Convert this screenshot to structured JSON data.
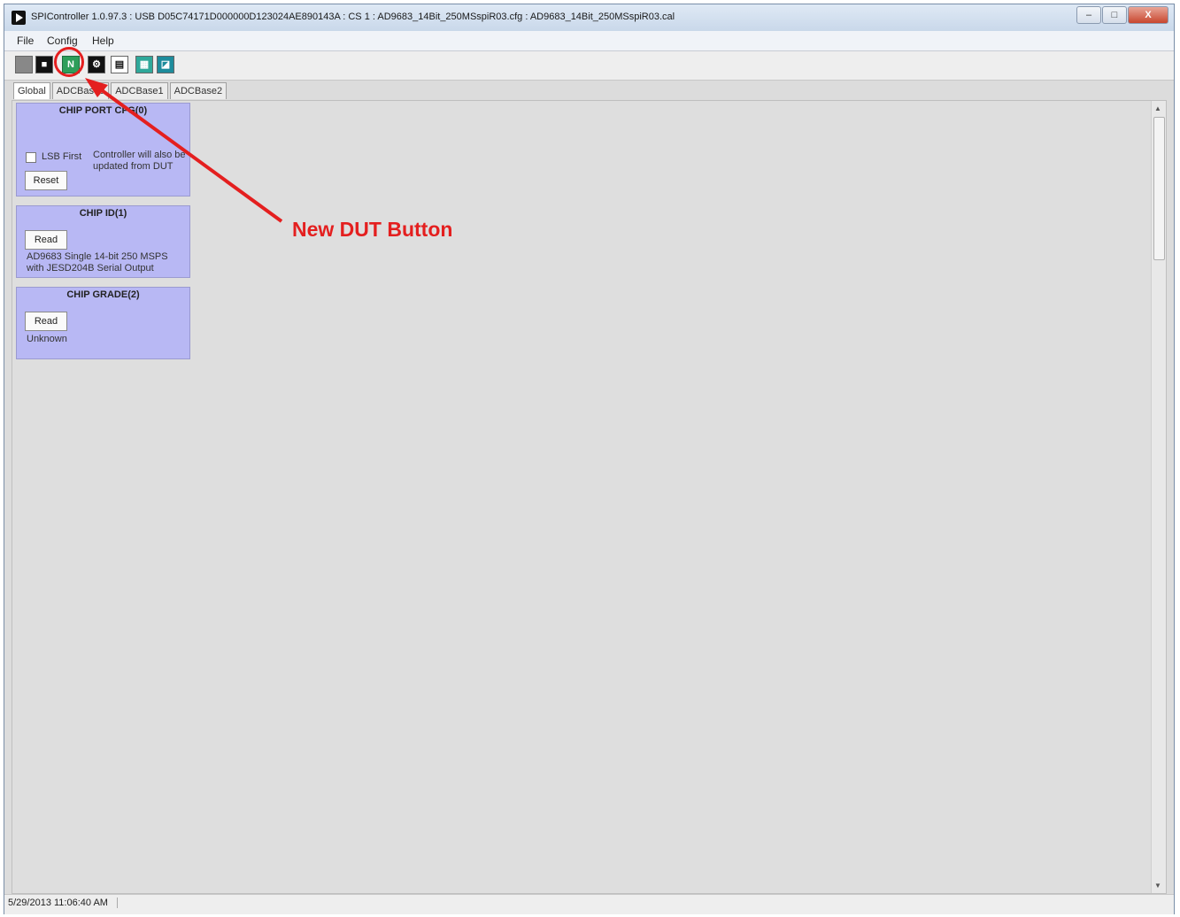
{
  "window": {
    "title": "SPIController 1.0.97.3 : USB D05C74171D000000D123024AE890143A : CS 1 : AD9683_14Bit_250MSspiR03.cfg : AD9683_14Bit_250MSspiR03.cal",
    "minimize_label": "–",
    "maximize_label": "□",
    "close_label": "X"
  },
  "menu": {
    "items": [
      "File",
      "Config",
      "Help"
    ]
  },
  "toolbar": {
    "buttons": [
      {
        "icon": "blank-icon"
      },
      {
        "icon": "chip-icon"
      },
      {
        "icon": "new-dut-icon",
        "label": "N"
      },
      {
        "icon": "gear-icon"
      },
      {
        "icon": "register-grid-icon"
      },
      {
        "icon": "monitor-icon"
      },
      {
        "icon": "chart-icon"
      }
    ]
  },
  "tabs": [
    "Global",
    "ADCBase0",
    "ADCBase1",
    "ADCBase2"
  ],
  "panels": {
    "chip_port_cfg": {
      "title": "CHIP PORT CFG(0)",
      "checkbox_label": "LSB First",
      "note": "Controller will also be updated from DUT",
      "button": "Reset"
    },
    "chip_id": {
      "title": "CHIP ID(1)",
      "button": "Read",
      "value": "AD9683 Single 14-bit 250 MSPS with JESD204B Serial Output"
    },
    "chip_grade": {
      "title": "CHIP GRADE(2)",
      "button": "Read",
      "value": "Unknown"
    }
  },
  "status": {
    "timestamp": "5/29/2013 11:06:40 AM"
  },
  "annotation": {
    "label": "New DUT Button",
    "color": "#e41f1f"
  }
}
